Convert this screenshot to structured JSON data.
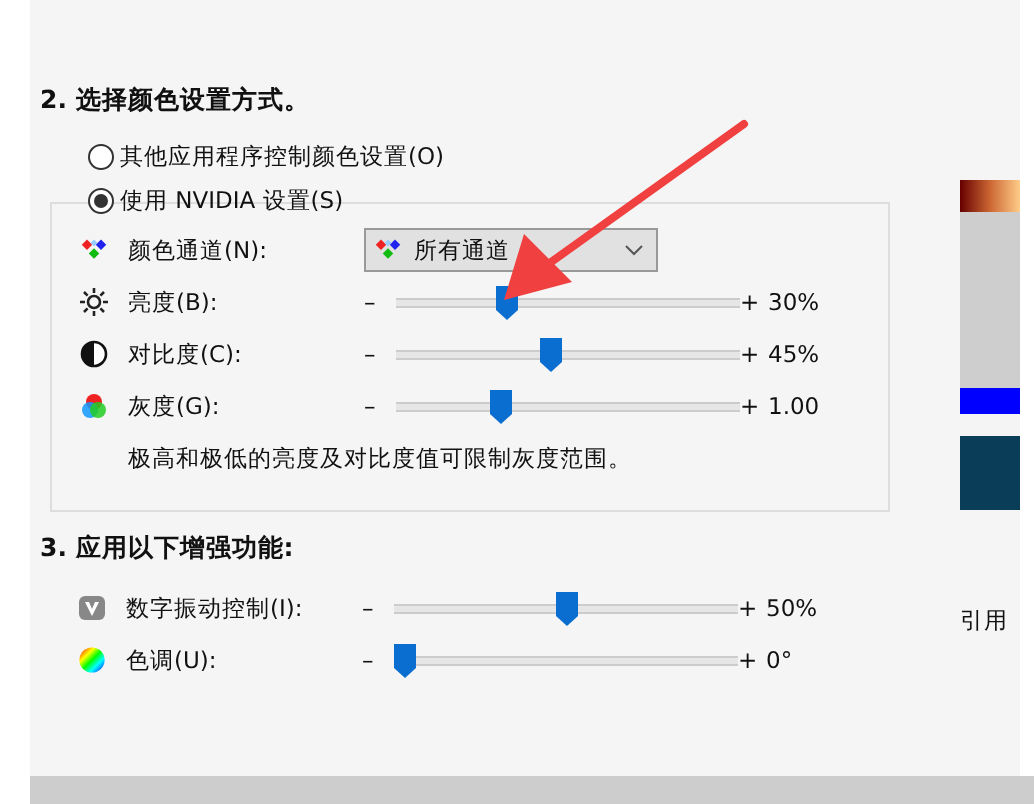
{
  "section2": {
    "heading": "2. 选择颜色设置方式。",
    "options": [
      {
        "label": "其他应用程序控制颜色设置(O)",
        "selected": false
      },
      {
        "label": "使用 NVIDIA 设置(S)",
        "selected": true
      }
    ],
    "channel": {
      "label": "颜色通道(N):",
      "value": "所有通道"
    },
    "adjustments": [
      {
        "kind": "brightness",
        "label": "亮度(B):",
        "minus": "–",
        "plus": "+",
        "level": 0.31,
        "reading": "30%"
      },
      {
        "kind": "contrast",
        "label": "对比度(C):",
        "minus": "–",
        "plus": "+",
        "level": 0.45,
        "reading": "45%"
      },
      {
        "kind": "gamma",
        "label": "灰度(G):",
        "minus": "–",
        "plus": "+",
        "level": 0.29,
        "reading": "1.00"
      }
    ],
    "note": "极高和极低的亮度及对比度值可限制灰度范围。"
  },
  "section3": {
    "heading": "3. 应用以下增强功能:",
    "adjustments": [
      {
        "kind": "vibrance",
        "label": "数字振动控制(I):",
        "minus": "–",
        "plus": "+",
        "level": 0.5,
        "reading": "50%"
      },
      {
        "kind": "hue",
        "label": "色调(U):",
        "minus": "–",
        "plus": "+",
        "level": 0,
        "reading": "0°"
      }
    ]
  },
  "side_panel": {
    "caption": "引用"
  }
}
